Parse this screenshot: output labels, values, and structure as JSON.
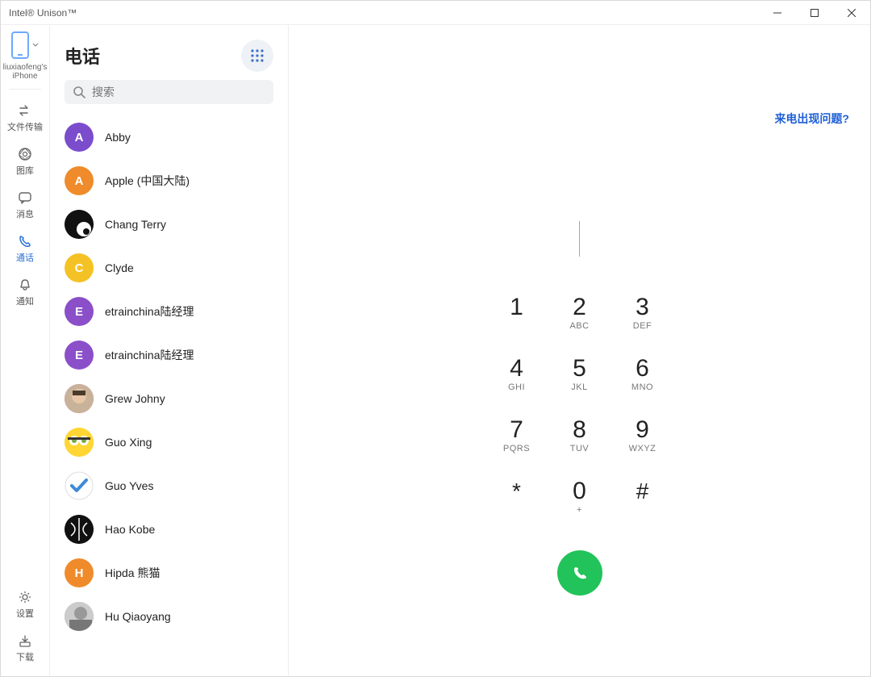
{
  "window": {
    "title": "Intel® Unison™"
  },
  "device": {
    "name": "liuxiaofeng's iPhone"
  },
  "sidebar": {
    "items": [
      {
        "key": "transfer",
        "label": "文件传输"
      },
      {
        "key": "gallery",
        "label": "图库"
      },
      {
        "key": "messages",
        "label": "消息"
      },
      {
        "key": "calls",
        "label": "通话"
      },
      {
        "key": "notify",
        "label": "通知"
      }
    ],
    "bottom": [
      {
        "key": "settings",
        "label": "设置"
      },
      {
        "key": "download",
        "label": "下载"
      }
    ]
  },
  "contacts": {
    "title": "电话",
    "search_placeholder": "搜索",
    "list": [
      {
        "name": "Abby",
        "initial": "A",
        "color": "#7b4ccc"
      },
      {
        "name": "Apple (中国大陆)",
        "initial": "A",
        "color": "#ef8b2a"
      },
      {
        "name": "Chang Terry",
        "initial": "",
        "color": "#111",
        "img": "ball"
      },
      {
        "name": "Clyde",
        "initial": "C",
        "color": "#f4c225"
      },
      {
        "name": "etrainchina陆经理",
        "initial": "E",
        "color": "#8b4fc9"
      },
      {
        "name": "etrainchina陆经理",
        "initial": "E",
        "color": "#8b4fc9"
      },
      {
        "name": "Grew Johny",
        "initial": "",
        "color": "#c49",
        "img": "face1"
      },
      {
        "name": "Guo Xing",
        "initial": "",
        "color": "#ffd633",
        "img": "minion"
      },
      {
        "name": "Guo Yves",
        "initial": "",
        "color": "#fff",
        "img": "check"
      },
      {
        "name": "Hao Kobe",
        "initial": "",
        "color": "#111",
        "img": "kobe"
      },
      {
        "name": "Hipda 熊猫",
        "initial": "H",
        "color": "#ef8b2a"
      },
      {
        "name": "Hu Qiaoyang",
        "initial": "",
        "color": "#888",
        "img": "bw"
      }
    ]
  },
  "main": {
    "problem_link": "来电出现问题?",
    "keys": [
      {
        "num": "1",
        "sub": ""
      },
      {
        "num": "2",
        "sub": "ABC"
      },
      {
        "num": "3",
        "sub": "DEF"
      },
      {
        "num": "4",
        "sub": "GHI"
      },
      {
        "num": "5",
        "sub": "JKL"
      },
      {
        "num": "6",
        "sub": "MNO"
      },
      {
        "num": "7",
        "sub": "PQRS"
      },
      {
        "num": "8",
        "sub": "TUV"
      },
      {
        "num": "9",
        "sub": "WXYZ"
      },
      {
        "num": "*",
        "sub": ""
      },
      {
        "num": "0",
        "sub": "+"
      },
      {
        "num": "#",
        "sub": ""
      }
    ]
  }
}
